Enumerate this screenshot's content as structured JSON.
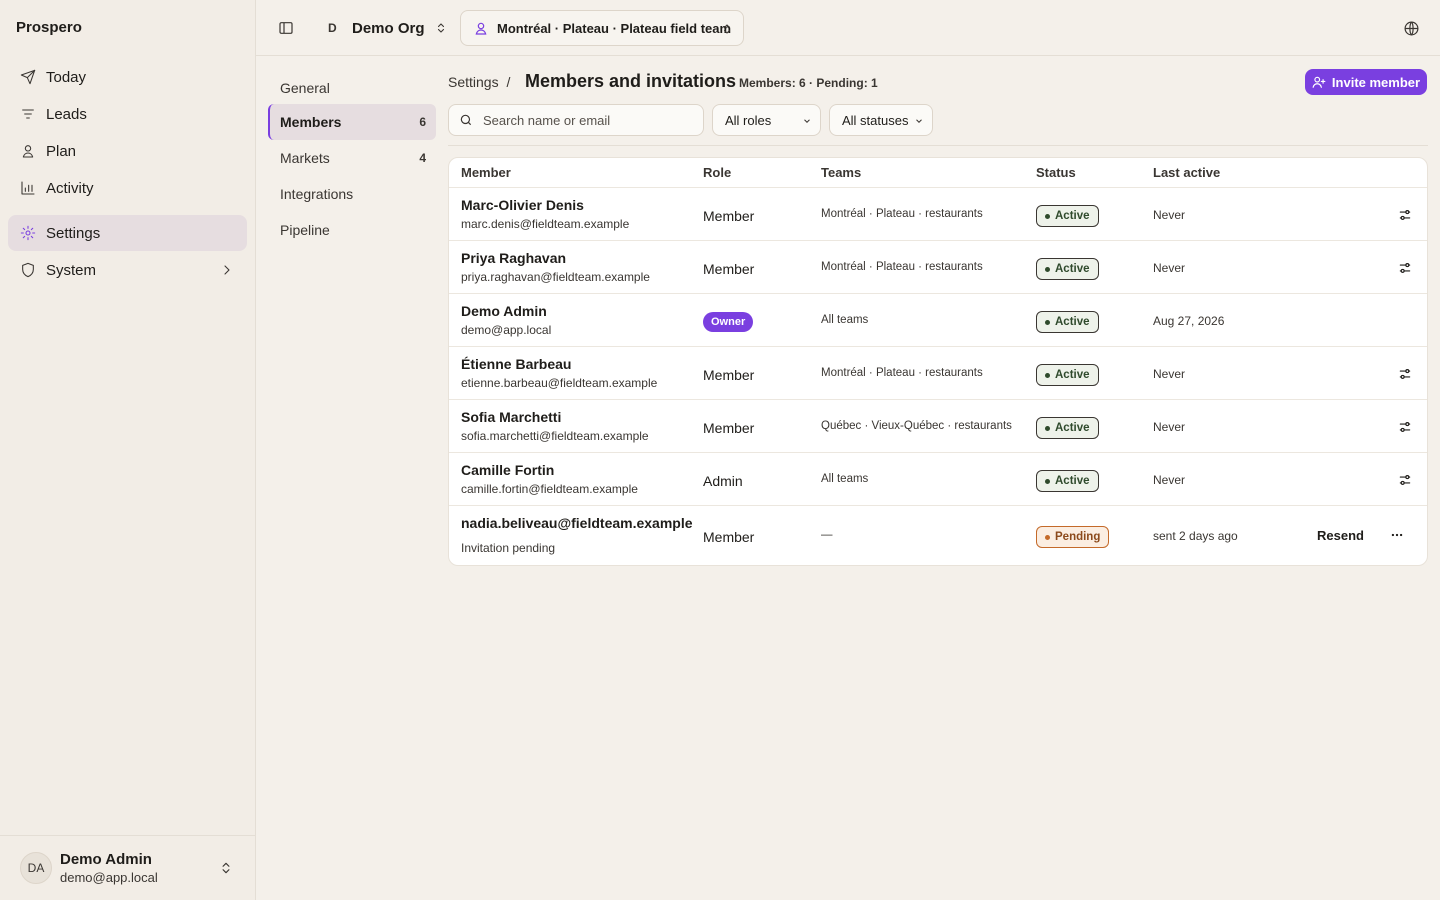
{
  "app": {
    "brand": "Prospero"
  },
  "sidebar": {
    "items": [
      {
        "label": "Today"
      },
      {
        "label": "Leads"
      },
      {
        "label": "Plan"
      },
      {
        "label": "Activity"
      },
      {
        "label": "Settings"
      },
      {
        "label": "System"
      }
    ],
    "user": {
      "initials": "DA",
      "name": "Demo Admin",
      "email": "demo@app.local"
    }
  },
  "topbar": {
    "org_initial": "D",
    "org_name": "Demo Org",
    "team": "Montréal · Plateau · Plateau field team"
  },
  "settings_nav": {
    "items": [
      {
        "label": "General",
        "count": ""
      },
      {
        "label": "Members",
        "count": "6"
      },
      {
        "label": "Markets",
        "count": "4"
      },
      {
        "label": "Integrations",
        "count": ""
      },
      {
        "label": "Pipeline",
        "count": ""
      }
    ]
  },
  "header": {
    "breadcrumb": "Settings",
    "separator": "/",
    "title": "Members and invitations",
    "summary": "Members: 6 · Pending: 1",
    "invite_label": "Invite member"
  },
  "filters": {
    "search_placeholder": "Search name or email",
    "roles": "All roles",
    "statuses": "All statuses"
  },
  "table": {
    "columns": [
      "Member",
      "Role",
      "Teams",
      "Status",
      "Last active"
    ],
    "rows": [
      {
        "name": "Marc-Olivier Denis",
        "email": "marc.denis@fieldteam.example",
        "role": "Member",
        "teams": "Montréal · Plateau · restaurants",
        "status": "Active",
        "last_active": "Never"
      },
      {
        "name": "Priya Raghavan",
        "email": "priya.raghavan@fieldteam.example",
        "role": "Member",
        "teams": "Montréal · Plateau · restaurants",
        "status": "Active",
        "last_active": "Never"
      },
      {
        "name": "Demo Admin",
        "email": "demo@app.local",
        "role": "Owner",
        "teams": "All teams",
        "status": "Active",
        "last_active": "Aug 27, 2026"
      },
      {
        "name": "Étienne Barbeau",
        "email": "etienne.barbeau@fieldteam.example",
        "role": "Member",
        "teams": "Montréal · Plateau · restaurants",
        "status": "Active",
        "last_active": "Never"
      },
      {
        "name": "Sofia Marchetti",
        "email": "sofia.marchetti@fieldteam.example",
        "role": "Member",
        "teams": "Québec · Vieux-Québec · restaurants",
        "status": "Active",
        "last_active": "Never"
      },
      {
        "name": "Camille Fortin",
        "email": "camille.fortin@fieldteam.example",
        "role": "Admin",
        "teams": "All teams",
        "status": "Active",
        "last_active": "Never"
      }
    ],
    "invitation": {
      "email": "nadia.beliveau@fieldteam.example",
      "note": "Invitation pending",
      "role": "Member",
      "teams": "—",
      "status": "Pending",
      "last_active": "sent 2 days ago",
      "resend_label": "Resend"
    }
  },
  "colors": {
    "accent": "#7a3fe0",
    "background": "#f4f0ea",
    "active_status": "#2f4a2c",
    "pending_status": "#c46a2a"
  },
  "icons": {
    "today": "send-icon",
    "leads": "list-icon",
    "plan": "user-pin-icon",
    "activity": "bar-chart-icon",
    "settings": "gear-icon",
    "system": "shield-icon",
    "row_action": "sliders-icon",
    "more": "more-horizontal-icon"
  }
}
